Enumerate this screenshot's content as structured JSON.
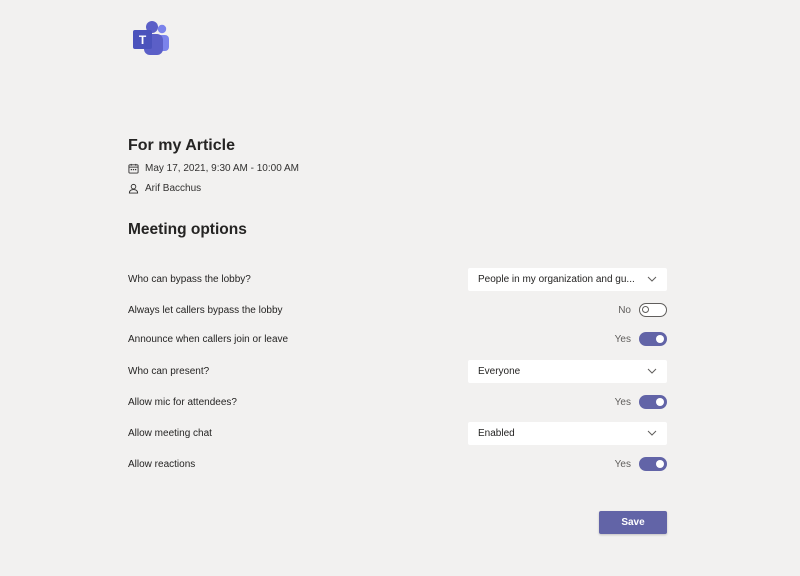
{
  "logo": {
    "icon": "microsoft-teams-logo-icon",
    "letter": "T",
    "color": "#5b5fc7"
  },
  "meeting": {
    "title": "For my Article",
    "datetime": "May 17, 2021, 9:30 AM - 10:00 AM",
    "datetime_icon": "calendar-icon",
    "organizer": "Arif Bacchus",
    "organizer_icon": "person-icon"
  },
  "options": {
    "heading": "Meeting options",
    "bypass_lobby": {
      "label": "Who can bypass the lobby?",
      "value": "People in my organization and gu..."
    },
    "callers_bypass": {
      "label": "Always let callers bypass the lobby",
      "state": "No",
      "on": false
    },
    "announce_callers": {
      "label": "Announce when callers join or leave",
      "state": "Yes",
      "on": true
    },
    "who_can_present": {
      "label": "Who can present?",
      "value": "Everyone"
    },
    "allow_mic": {
      "label": "Allow mic for attendees?",
      "state": "Yes",
      "on": true
    },
    "meeting_chat": {
      "label": "Allow meeting chat",
      "value": "Enabled"
    },
    "allow_reactions": {
      "label": "Allow reactions",
      "state": "Yes",
      "on": true
    }
  },
  "save_button": {
    "label": "Save"
  },
  "colors": {
    "accent": "#6264a7",
    "background": "#f2f1f0",
    "text": "#252423"
  }
}
